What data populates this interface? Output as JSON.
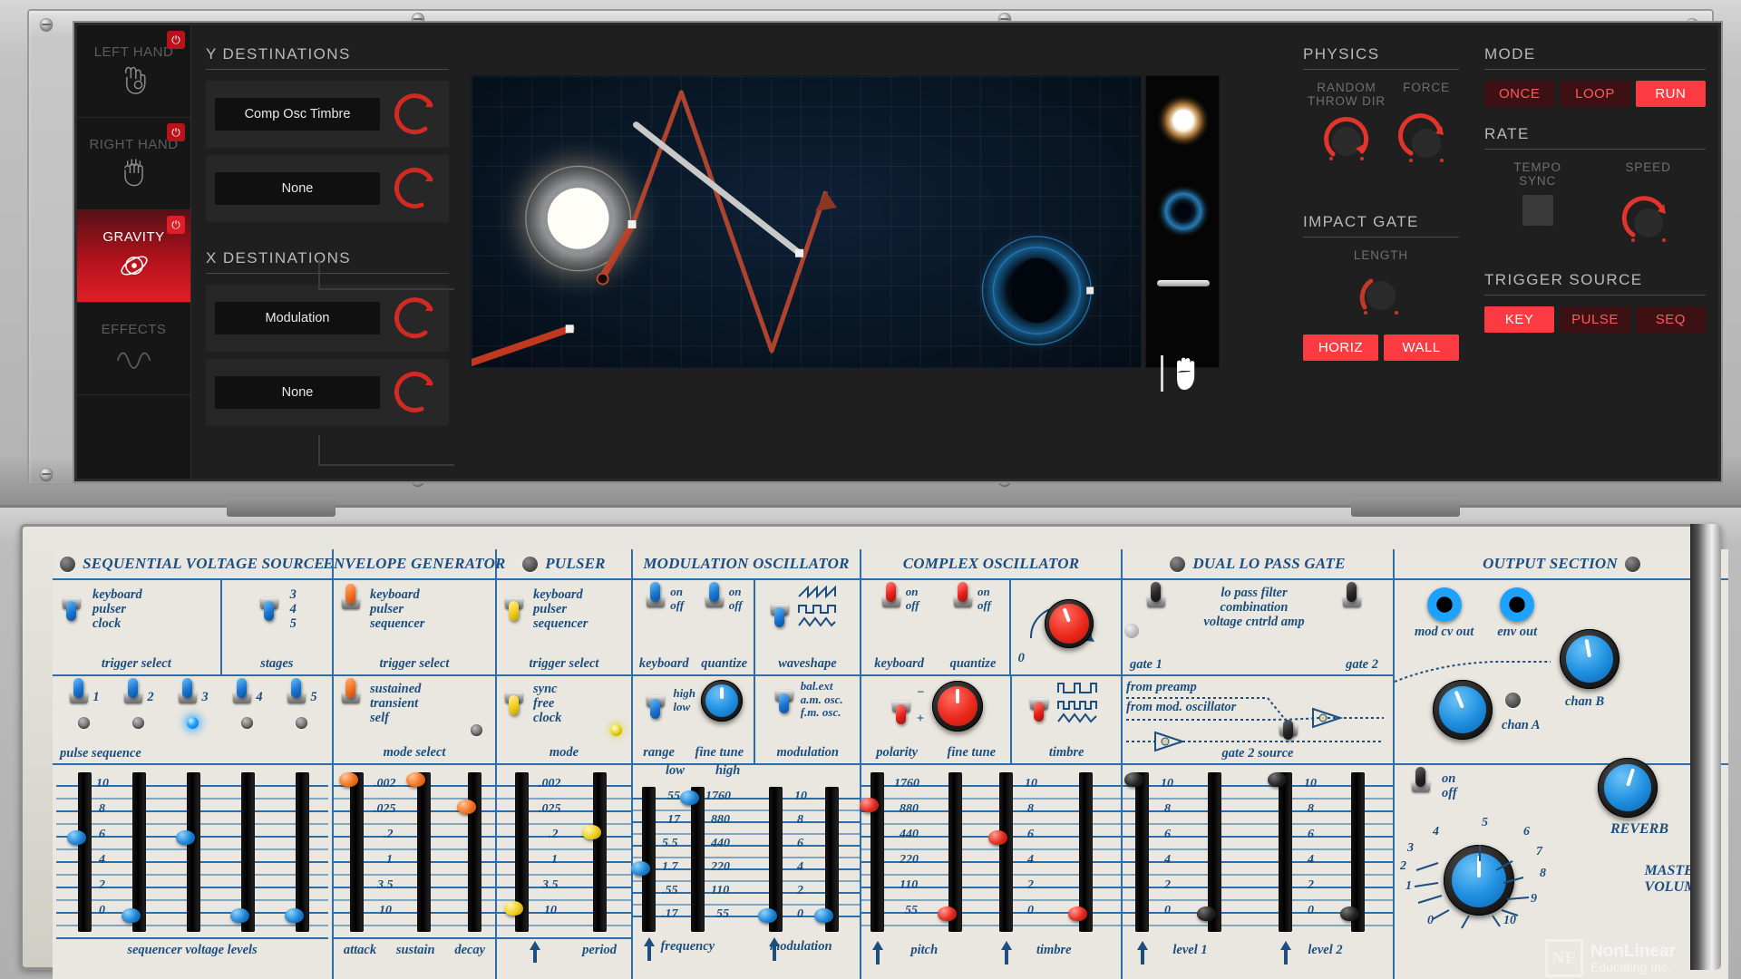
{
  "app": {
    "plugin_panel": {
      "rail": [
        {
          "label": "LEFT HAND",
          "icon": "hand-pinch-icon",
          "active": false,
          "power": "⏻"
        },
        {
          "label": "RIGHT HAND",
          "icon": "hand-open-icon",
          "active": false,
          "power": "⏻"
        },
        {
          "label": "GRAVITY",
          "icon": "atom-icon",
          "active": true,
          "power": "⏻"
        },
        {
          "label": "EFFECTS",
          "icon": "waveform-icon",
          "active": false,
          "power": ""
        }
      ],
      "y_destinations": {
        "title": "Y DESTINATIONS",
        "rows": [
          {
            "value": "Comp Osc Timbre",
            "knob": "amount-knob"
          },
          {
            "value": "None",
            "knob": "amount-knob"
          }
        ]
      },
      "x_destinations": {
        "title": "X DESTINATIONS",
        "rows": [
          {
            "value": "Modulation",
            "knob": "amount-knob"
          },
          {
            "value": "None",
            "knob": "amount-knob"
          }
        ]
      },
      "sim": {
        "name": "gravity-physics-canvas",
        "tools": [
          {
            "name": "sun-emitter-tool",
            "selected": false
          },
          {
            "name": "blackhole-tool",
            "selected": false
          },
          {
            "name": "wall-tool",
            "selected": false
          },
          {
            "name": "hand-grab-tool",
            "selected": true
          }
        ]
      },
      "physics": {
        "title": "PHYSICS",
        "knobs": [
          {
            "label": "RANDOM\nTHROW DIR",
            "label_line1": "RANDOM",
            "label_line2": "THROW DIR",
            "value_pct": 72
          },
          {
            "label": "FORCE",
            "label_line1": "FORCE",
            "label_line2": "",
            "value_pct": 80
          }
        ]
      },
      "impact_gate": {
        "title": "IMPACT GATE",
        "knob_label": "LENGTH",
        "knob_value_pct": 30,
        "buttons": [
          {
            "label": "HORIZ",
            "active": true
          },
          {
            "label": "WALL",
            "active": true
          }
        ]
      },
      "mode": {
        "title": "MODE",
        "buttons": [
          {
            "label": "ONCE",
            "active": false
          },
          {
            "label": "LOOP",
            "active": false
          },
          {
            "label": "RUN",
            "active": true
          }
        ]
      },
      "rate": {
        "title": "RATE",
        "tempo_sync_label_line1": "TEMPO",
        "tempo_sync_label_line2": "SYNC",
        "tempo_sync_on": false,
        "speed_label": "SPEED",
        "speed_value_pct": 78
      },
      "trigger_source": {
        "title": "TRIGGER SOURCE",
        "buttons": [
          {
            "label": "KEY",
            "active": true
          },
          {
            "label": "PULSE",
            "active": false
          },
          {
            "label": "SEQ",
            "active": false
          }
        ]
      }
    },
    "hardware_panel": {
      "modules": [
        {
          "title": "SEQUENTIAL VOLTAGE SOURCE",
          "name": "module-sequential-voltage-source",
          "cells": [
            {
              "label": "trigger select",
              "options": [
                "keyboard",
                "pulser",
                "clock"
              ],
              "switch_color": "blue",
              "switch_pos": "dn"
            },
            {
              "label": "stages",
              "options": [
                "3",
                "4",
                "5"
              ],
              "switch_color": "blue",
              "switch_pos": "dn"
            }
          ],
          "pulse_sequence": {
            "label": "pulse sequence",
            "steps": [
              "1",
              "2",
              "3",
              "4",
              "5"
            ],
            "active_step": 3
          },
          "slider_group": {
            "label": "sequencer voltage levels",
            "scale": [
              "10",
              "8",
              "6",
              "4",
              "2",
              "0"
            ],
            "values": [
              5.0,
              0.2,
              5.0,
              0.2,
              0.2
            ]
          }
        },
        {
          "title": "ENVELOPE GENERATOR",
          "name": "module-envelope-generator",
          "cells": [
            {
              "label": "trigger select",
              "options": [
                "keyboard",
                "pulser",
                "sequencer"
              ],
              "switch_color": "orange",
              "switch_pos": "up"
            },
            {
              "label": "mode select",
              "options": [
                "sustained",
                "transient",
                "self"
              ],
              "switch_color": "orange",
              "switch_pos": "up"
            }
          ],
          "slider_group": {
            "labels": [
              "attack",
              "sustain",
              "decay"
            ],
            "scale": [
              ".002",
              ".025",
              ".2",
              "1",
              "3.5",
              "10"
            ],
            "values": [
              ".002",
              ".002",
              ".025"
            ]
          }
        },
        {
          "title": "PULSER",
          "name": "module-pulser",
          "cells": [
            {
              "label": "trigger select",
              "options": [
                "keyboard",
                "pulser",
                "sequencer"
              ],
              "switch_color": "yellow",
              "switch_pos": "dn"
            },
            {
              "label": "mode",
              "options": [
                "sync",
                "free",
                "clock"
              ],
              "switch_color": "yellow",
              "switch_pos": "dn"
            }
          ],
          "slider_group": {
            "labels": [
              "period"
            ],
            "scale": [
              ".002",
              ".025",
              ".2",
              "1",
              "3.5",
              "10"
            ],
            "values": [
              "10",
              ".2"
            ]
          }
        },
        {
          "title": "MODULATION OSCILLATOR",
          "name": "module-modulation-oscillator",
          "cells": [
            {
              "label": "keyboard",
              "options": [
                "on",
                "off"
              ],
              "switch_color": "blue",
              "switch_pos": "up"
            },
            {
              "label": "quantize",
              "options": [
                "on",
                "off"
              ],
              "switch_color": "blue",
              "switch_pos": "up"
            },
            {
              "label": "waveshape",
              "options": [
                "saw",
                "square",
                "triangle"
              ],
              "switch_color": "blue",
              "switch_pos": "dn"
            },
            {
              "label": "range",
              "options": [
                "high",
                "low"
              ],
              "switch_color": "blue",
              "switch_pos": "dn"
            },
            {
              "label": "fine tune",
              "knob_color": "blue",
              "knob_angle": 0
            },
            {
              "label": "modulation",
              "options": [
                "bal.ext",
                "a.m. osc.",
                "f.m. osc."
              ],
              "switch_color": "blue",
              "switch_pos": "dn"
            }
          ],
          "slider_group": {
            "labels": [
              "frequency",
              "modulation"
            ],
            "headers": [
              "low",
              "high"
            ],
            "scale_low": [
              "55",
              "17",
              "5.5",
              "1.7",
              ".55",
              ".17"
            ],
            "scale_high": [
              "1760",
              "880",
              "440",
              "220",
              "110",
              "55"
            ],
            "scale_mod": [
              "10",
              "8",
              "6",
              "4",
              "2",
              "0"
            ],
            "values": [
              "1.7",
              "1760",
              "0",
              "0"
            ]
          }
        },
        {
          "title": "COMPLEX OSCILLATOR",
          "name": "module-complex-oscillator",
          "cells": [
            {
              "label": "keyboard",
              "options": [
                "on",
                "off"
              ],
              "switch_color": "red",
              "switch_pos": "up"
            },
            {
              "label": "quantize",
              "options": [
                "on",
                "off"
              ],
              "switch_color": "red",
              "switch_pos": "up"
            },
            {
              "label": "polarity",
              "options": [
                "−",
                "+"
              ],
              "switch_color": "red",
              "switch_pos": "dn"
            },
            {
              "label": "fine tune",
              "knob_color": "red",
              "knob_angle": 0
            },
            {
              "label": "timbre",
              "options": [
                "pulse",
                "square",
                "triangle"
              ],
              "switch_color": "red",
              "switch_pos": "dn"
            },
            {
              "label": "timbre",
              "knob_color": "red",
              "knob_angle": -20,
              "zero_label": "0"
            }
          ],
          "slider_group": {
            "labels": [
              "pitch",
              "timbre"
            ],
            "scale_pitch": [
              "1760",
              "880",
              "440",
              "220",
              "110",
              "55"
            ],
            "scale_timbre": [
              "10",
              "8",
              "6",
              "4",
              "2",
              "0"
            ],
            "values": [
              "880",
              "55",
              "5",
              "0"
            ]
          }
        },
        {
          "title": "DUAL LO PASS GATE",
          "name": "module-dual-lo-pass-gate",
          "cells": [
            {
              "label": "gate 1",
              "options": [
                "lo pass filter",
                "combination",
                "voltage cntrld amp"
              ],
              "switch_color": "black",
              "switch_pos": "up"
            },
            {
              "label": "gate 2",
              "options": [
                "lo pass filter",
                "combination",
                "voltage cntrld amp"
              ],
              "switch_color": "black",
              "switch_pos": "up"
            },
            {
              "label": "gate 2 source",
              "options": [
                "from preamp",
                "from mod. oscillator"
              ],
              "switch_color": "black",
              "switch_pos": "mid"
            }
          ],
          "slider_group": {
            "labels": [
              "level 1",
              "level 2"
            ],
            "scale": [
              "10",
              "8",
              "6",
              "4",
              "2",
              "0"
            ],
            "values": [
              "10",
              "0",
              "10",
              "0"
            ]
          }
        },
        {
          "title": "OUTPUT SECTION",
          "name": "module-output-section",
          "jacks": [
            {
              "label": "mod cv out"
            },
            {
              "label": "env out"
            }
          ],
          "knobs": [
            {
              "label": "chan A",
              "color": "blue",
              "angle": -22
            },
            {
              "label": "chan B",
              "color": "blue",
              "angle": -10
            },
            {
              "label": "REVERB",
              "color": "blue",
              "angle": 18
            },
            {
              "label": "MASTER VOLUME",
              "color": "blue",
              "angle": 0
            }
          ],
          "toggle": {
            "label_on": "on",
            "label_off": "off",
            "switch_color": "black",
            "switch_pos": "up"
          },
          "master_scale": [
            "0",
            "1",
            "2",
            "3",
            "4",
            "5",
            "6",
            "7",
            "8",
            "9",
            "10"
          ]
        }
      ],
      "watermark": {
        "mark": "NE",
        "line1": "NonLinear",
        "line2": "Educating Inc."
      }
    },
    "colors": {
      "accent_red": "#fb3b41",
      "panel_blue": "#1c4e7f",
      "line_blue": "#2c6ea8",
      "panel_cream": "#e9e7df"
    }
  }
}
